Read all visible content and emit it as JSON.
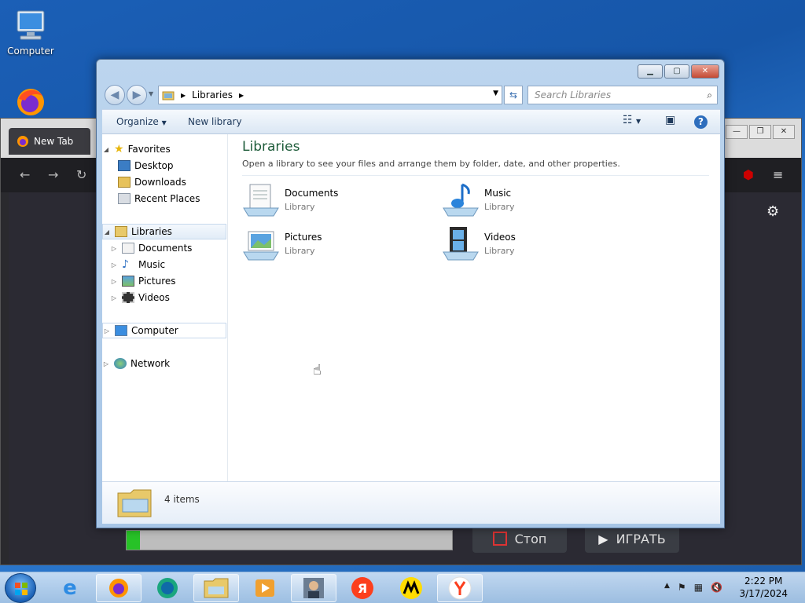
{
  "desktop": {
    "icons": [
      {
        "label": "Computer",
        "icon": "computer-icon"
      },
      {
        "label": "",
        "icon": "firefox-icon"
      }
    ]
  },
  "firefox": {
    "tab_label": "New Tab",
    "progress_percent": 4,
    "stop_label": "Стоп",
    "play_label": "ИГРАТЬ"
  },
  "explorer": {
    "address": {
      "crumb": "Libraries"
    },
    "search": {
      "placeholder": "Search Libraries"
    },
    "cmdbar": {
      "organize": "Organize",
      "new_library": "New library"
    },
    "nav": {
      "favorites": "Favorites",
      "desktop": "Desktop",
      "downloads": "Downloads",
      "recent": "Recent Places",
      "libraries": "Libraries",
      "documents": "Documents",
      "music": "Music",
      "pictures": "Pictures",
      "videos": "Videos",
      "computer": "Computer",
      "network": "Network"
    },
    "content": {
      "title": "Libraries",
      "description": "Open a library to see your files and arrange them by folder, date, and other properties.",
      "libraries": [
        {
          "name": "Documents",
          "type": "Library"
        },
        {
          "name": "Music",
          "type": "Library"
        },
        {
          "name": "Pictures",
          "type": "Library"
        },
        {
          "name": "Videos",
          "type": "Library"
        }
      ]
    },
    "details": {
      "count": "4 items"
    }
  },
  "taskbar": {
    "time": "2:22 PM",
    "date": "3/17/2024"
  },
  "colors": {
    "accent": "#1e5c3a",
    "title_bar": "#bcd5ee",
    "progress_fill": "#27c227"
  }
}
